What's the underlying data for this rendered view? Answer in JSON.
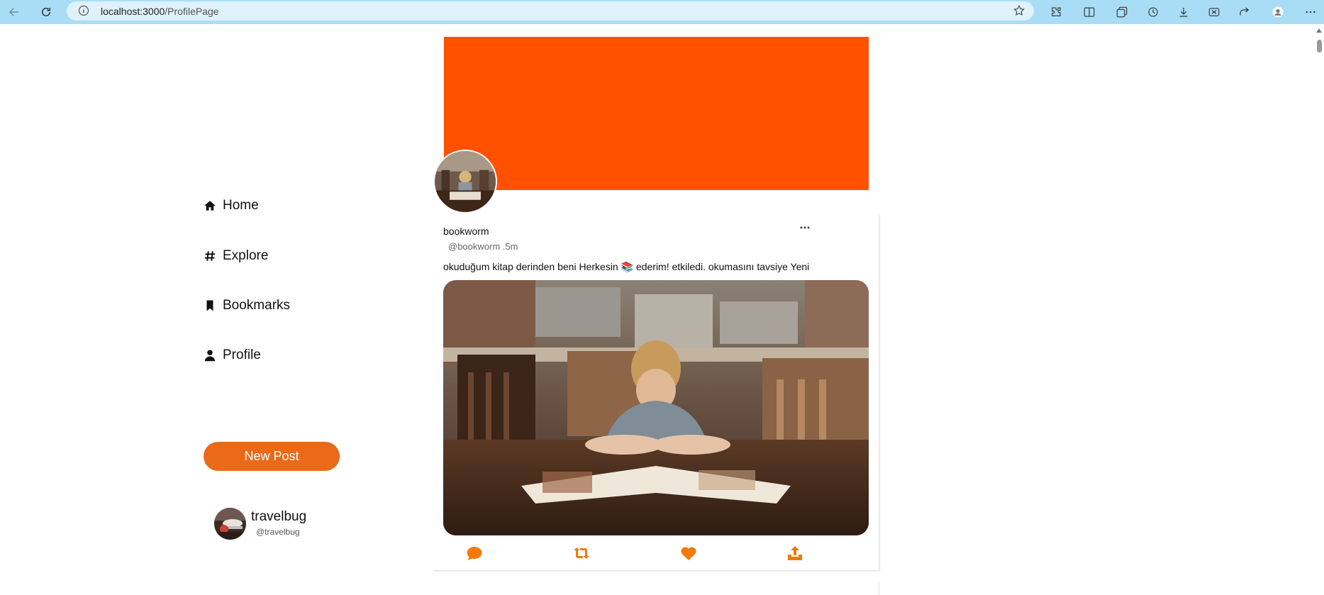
{
  "browser": {
    "url_host": "localhost:3000",
    "url_path": "/ProfilePage"
  },
  "sidebar": {
    "items": [
      {
        "label": "Home",
        "icon": "home-icon"
      },
      {
        "label": "Explore",
        "icon": "hashtag-icon"
      },
      {
        "label": "Bookmarks",
        "icon": "bookmark-icon"
      },
      {
        "label": "Profile",
        "icon": "user-icon"
      }
    ],
    "new_post_label": "New Post",
    "current_user": {
      "name": "travelbug",
      "handle": "@travelbug"
    }
  },
  "profile": {
    "banner_color": "#ff5100"
  },
  "post": {
    "author": "bookworm",
    "meta": "@bookworm .5m",
    "text": "okuduğum kitap derinden beni Herkesin 📚 ederim! etkiledi. okumasını tavsiye Yeni",
    "actions": [
      "comment-icon",
      "retweet-icon",
      "heart-icon",
      "share-icon"
    ]
  },
  "colors": {
    "accent": "#ea6a1a",
    "action_icon": "#f27a0a",
    "browser_bar": "#a9ddf5"
  }
}
